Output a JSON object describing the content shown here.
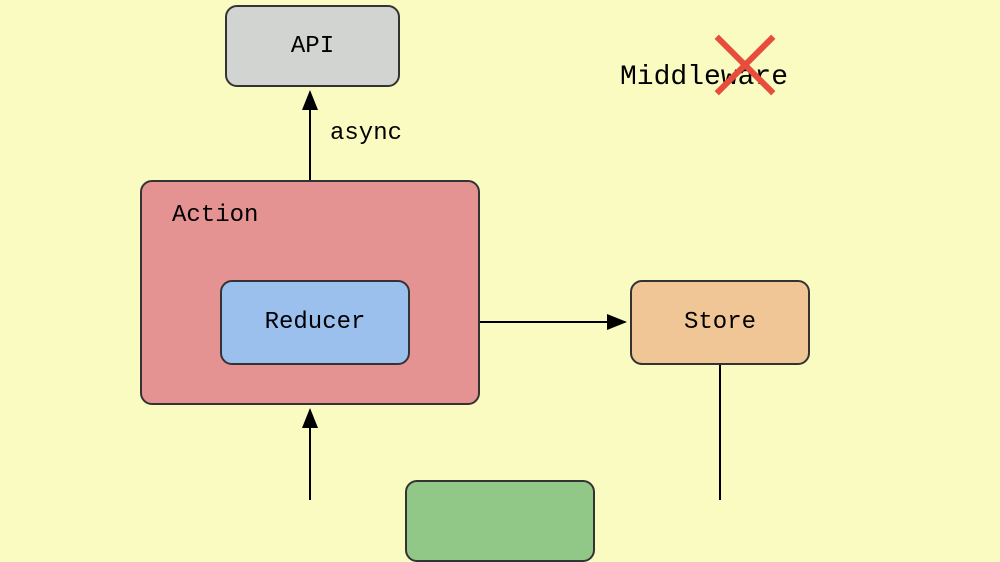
{
  "nodes": {
    "api": {
      "label": "API"
    },
    "action": {
      "label": "Action"
    },
    "reducer": {
      "label": "Reducer"
    },
    "store": {
      "label": "Store"
    },
    "middleware": {
      "label": "Middleware"
    }
  },
  "edges": {
    "async": {
      "label": "async"
    }
  },
  "colors": {
    "background": "#fafbc1",
    "api": "#d1d4d0",
    "action": "#e59292",
    "reducer": "#9bc0ee",
    "store": "#f1c697",
    "green": "#92c887",
    "xmark": "#e74c3c"
  }
}
